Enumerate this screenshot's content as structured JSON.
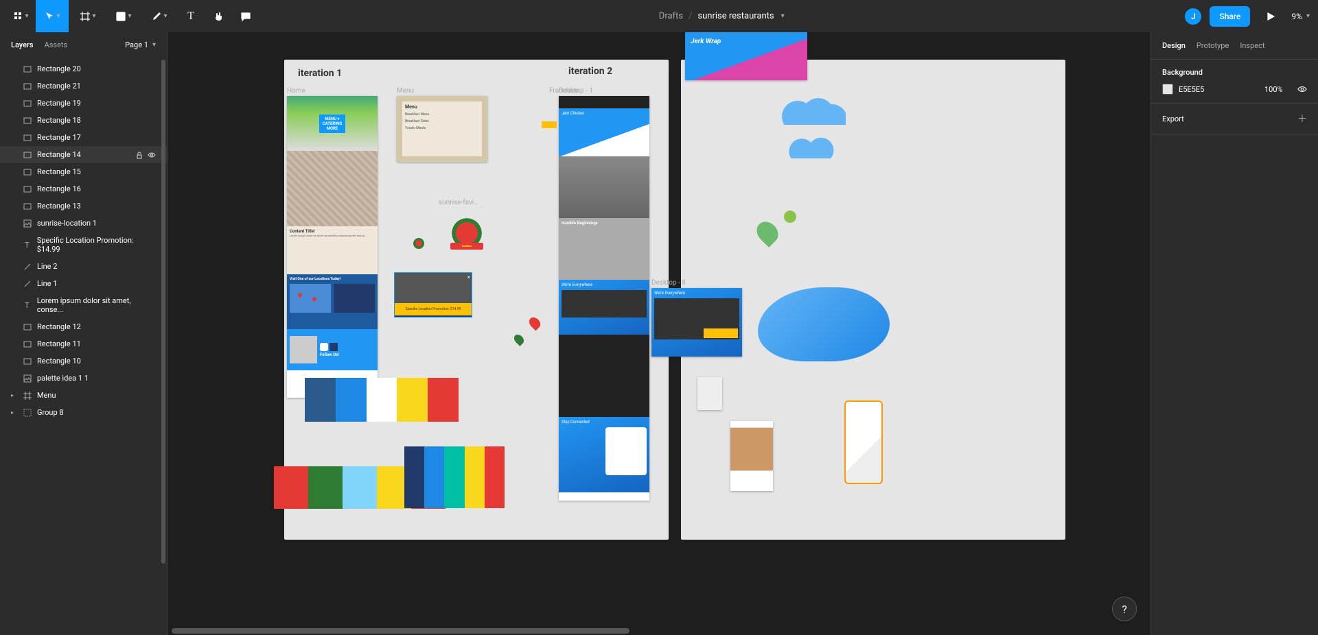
{
  "toolbar": {
    "breadcrumb_root": "Drafts",
    "breadcrumb_sep": "/",
    "file_name": "sunrise restaurants",
    "share_label": "Share",
    "avatar_initial": "J",
    "zoom": "9%"
  },
  "left_panel": {
    "tab_layers": "Layers",
    "tab_assets": "Assets",
    "page_label": "Page 1",
    "layers": [
      {
        "name": "Rectangle 20",
        "icon": "rect"
      },
      {
        "name": "Rectangle 21",
        "icon": "rect"
      },
      {
        "name": "Rectangle 19",
        "icon": "rect"
      },
      {
        "name": "Rectangle 18",
        "icon": "rect"
      },
      {
        "name": "Rectangle 17",
        "icon": "rect"
      },
      {
        "name": "Rectangle 14",
        "icon": "rect",
        "hovered": true
      },
      {
        "name": "Rectangle 15",
        "icon": "rect"
      },
      {
        "name": "Rectangle 16",
        "icon": "rect"
      },
      {
        "name": "Rectangle 13",
        "icon": "rect"
      },
      {
        "name": "sunrise-location 1",
        "icon": "image"
      },
      {
        "name": "Specific Location Promotion: $14.99",
        "icon": "text"
      },
      {
        "name": "Line 2",
        "icon": "line"
      },
      {
        "name": "Line 1",
        "icon": "line"
      },
      {
        "name": "Lorem ipsum dolor sit amet, conse...",
        "icon": "text"
      },
      {
        "name": "Rectangle 12",
        "icon": "rect"
      },
      {
        "name": "Rectangle 11",
        "icon": "rect"
      },
      {
        "name": "Rectangle 10",
        "icon": "rect"
      },
      {
        "name": "palette idea 1 1",
        "icon": "image"
      },
      {
        "name": "Menu",
        "icon": "frame",
        "expandable": true
      },
      {
        "name": "Group 8",
        "icon": "group",
        "expandable": true
      }
    ]
  },
  "right_panel": {
    "tab_design": "Design",
    "tab_prototype": "Prototype",
    "tab_inspect": "Inspect",
    "background_label": "Background",
    "bg_hex": "E5E5E5",
    "bg_opacity": "100%",
    "export_label": "Export"
  },
  "canvas": {
    "iteration1_label": "iteration 1",
    "iteration2_label": "iteration 2",
    "frame_home": "Home",
    "frame_menu": "Menu",
    "frame_franchise": "Franchise",
    "frame_desktop1": "Desktop - 1",
    "frame_desktop8": "Desktop - 8",
    "favi_label": "sunrise-favi...",
    "menu_title": "Menu",
    "menu_items": [
      "Breakfast Menu",
      "Breakfast Sides",
      "Yosalu Meats"
    ],
    "home_menu": "MENU ▾",
    "home_catering": "CATERING",
    "home_more": "MORE",
    "home_content_title": "Content Title!",
    "home_visit": "Visit One of our Locations Today!",
    "home_follow": "Follow Us!",
    "promo_text": "Specific Location Promotion: $14.99",
    "d1_jerk": "Jerk Chicken",
    "d1_humble": "Humble Beginnings",
    "d1_everywhere": "We're Everywhere",
    "d1_stay": "Stay Connected",
    "d8_everywhere": "We're Everywhere",
    "jerk_wrap": "Jerk Wrap",
    "palettes": {
      "p1": [
        "#2b5b8c",
        "#1e88e5",
        "#ffffff",
        "#f9d71c",
        "#e53935"
      ],
      "p2": [
        "#e53935",
        "#2e7d32",
        "#81d4fa",
        "#f9d71c",
        "#e53935"
      ],
      "p3": [
        "#1f3a6b",
        "#1e88e5",
        "#00bfa5",
        "#f9d71c",
        "#e53935"
      ]
    }
  },
  "help": "?"
}
